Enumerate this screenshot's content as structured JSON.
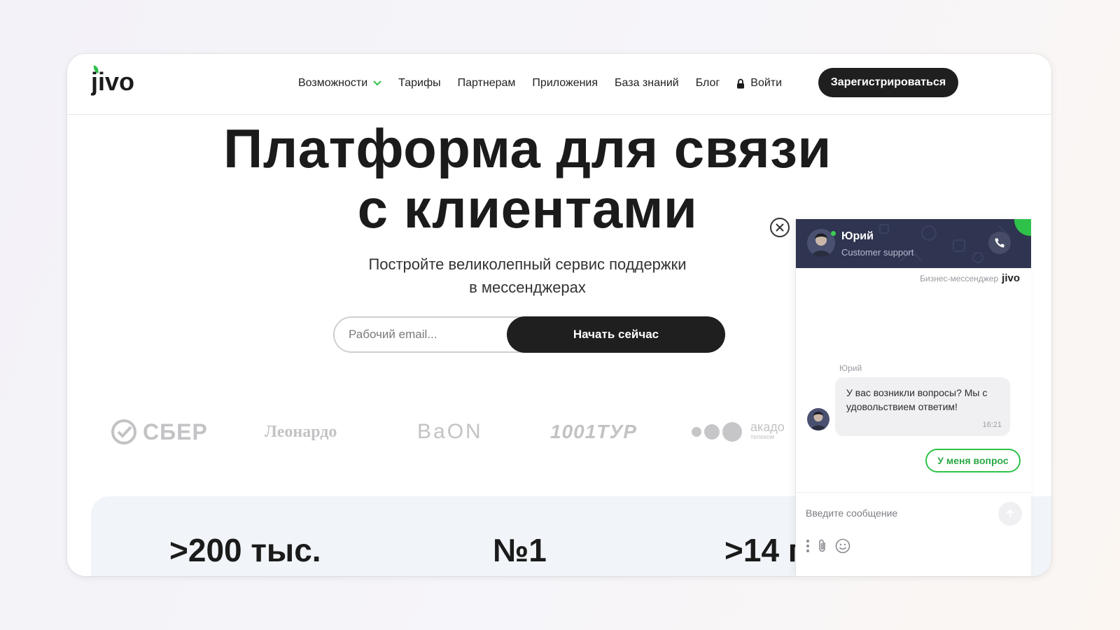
{
  "header": {
    "logo_text": "jivo",
    "nav": [
      {
        "label": "Возможности",
        "has_dropdown": true
      },
      {
        "label": "Тарифы"
      },
      {
        "label": "Партнерам"
      },
      {
        "label": "Приложения"
      },
      {
        "label": "База знаний"
      },
      {
        "label": "Блог"
      }
    ],
    "login_label": "Войти",
    "signup_label": "Зарегистрироваться"
  },
  "hero": {
    "title_line1": "Платформа для связи",
    "title_line2": "с клиентами",
    "subtitle_line1": "Постройте великолепный сервис поддержки",
    "subtitle_line2": "в мессенджерах",
    "email_placeholder": "Рабочий email...",
    "cta_label": "Начать сейчас"
  },
  "clients": [
    {
      "name": "СБЕР"
    },
    {
      "name": "Леонардо"
    },
    {
      "name": "BaON"
    },
    {
      "name": "1001ТУР"
    },
    {
      "name": "акадо",
      "sub": "телеком"
    }
  ],
  "stats": [
    {
      "value": ">200 тыс."
    },
    {
      "value": "№1"
    },
    {
      "value": ">14 г"
    }
  ],
  "chat": {
    "agent_name": "Юрий",
    "agent_role": "Customer support",
    "brand_caption": "Бизнес-мессенджер",
    "brand_logo": "jivo",
    "message_author": "Юрий",
    "message_text": "У вас возникли вопросы? Мы с удовольствием ответим!",
    "message_time": "16:21",
    "quick_reply": "У меня вопрос",
    "input_placeholder": "Введите сообщение"
  },
  "colors": {
    "accent_green": "#2ec24a",
    "dark_button": "#1f1f1f",
    "chat_header": "#2f3450"
  },
  "icons": [
    "chevron-down-icon",
    "lock-icon",
    "close-icon",
    "phone-icon",
    "send-arrow-icon",
    "more-vertical-icon",
    "paperclip-icon",
    "emoji-icon",
    "sber-check-icon"
  ]
}
